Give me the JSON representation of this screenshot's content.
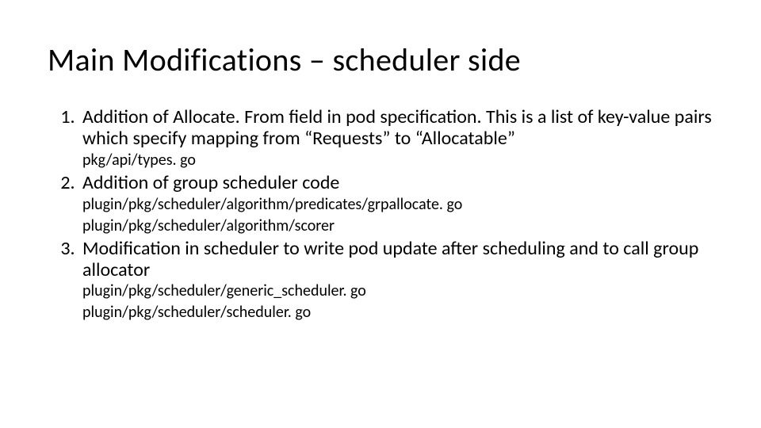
{
  "title": "Main Modifications – scheduler side",
  "items": [
    {
      "main": "Addition of Allocate. From field in pod specification.  This is a list of key-value pairs which specify mapping from “Requests” to “Allocatable”",
      "subs": [
        "pkg/api/types. go"
      ]
    },
    {
      "main": "Addition of group scheduler code",
      "subs": [
        "plugin/pkg/scheduler/algorithm/predicates/grpallocate. go",
        "plugin/pkg/scheduler/algorithm/scorer"
      ]
    },
    {
      "main": "Modification in scheduler to write pod update after scheduling and to call group allocator",
      "subs": [
        "plugin/pkg/scheduler/generic_scheduler. go",
        "plugin/pkg/scheduler/scheduler. go"
      ]
    }
  ]
}
